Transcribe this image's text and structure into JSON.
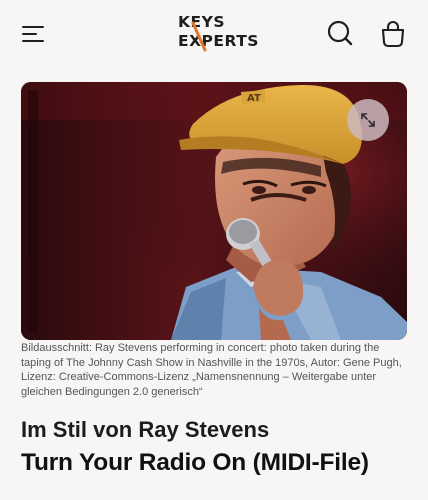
{
  "header": {
    "logo_line1": "KEYS",
    "logo_line2": "EXPERTS",
    "icons": {
      "menu": "hamburger-menu-icon",
      "search": "search-icon",
      "cart": "shopping-bag-icon"
    },
    "accent_color": "#e0772f"
  },
  "hero": {
    "image_subject": "Ray Stevens performing in concert, singing into a microphone, wearing a yellow cap",
    "expand_icon": "expand-arrows-icon"
  },
  "caption": "Bildausschnitt: Ray Stevens performing in concert: photo taken during the taping of The Johnny Cash Show in Nashville in the 1970s, Autor: Gene Pugh, Lizenz: Creative-Commons-Lizenz „Namensnennung – Weitergabe unter gleichen Bedingungen 2.0 generisch“",
  "product": {
    "artist_line": "Im Stil von Ray Stevens",
    "title": "Turn Your Radio On (MIDI-File)"
  }
}
